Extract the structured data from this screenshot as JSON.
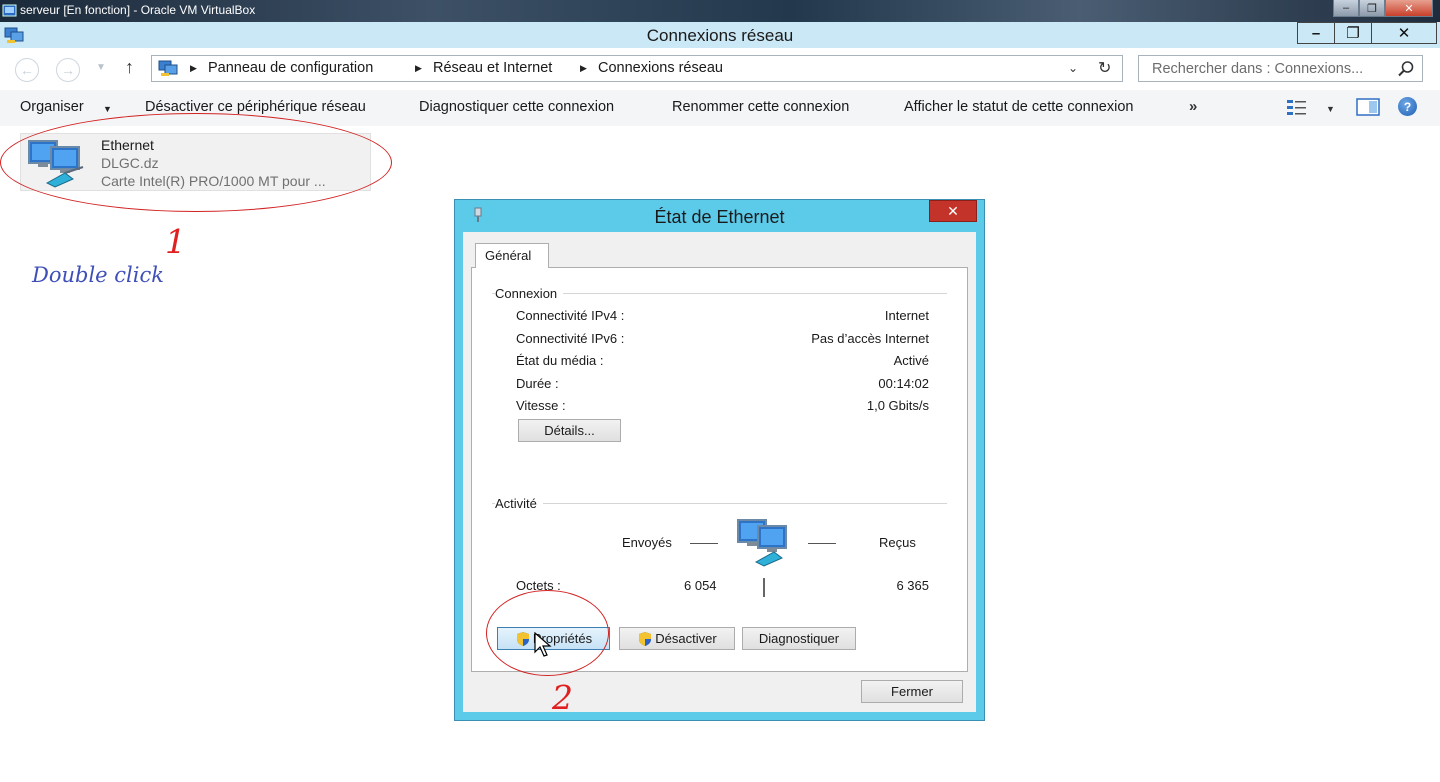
{
  "vbox": {
    "title": "serveur [En fonction] - Oracle VM VirtualBox",
    "close_glyph": "✕",
    "min_glyph": "–",
    "max_glyph": "❐"
  },
  "window": {
    "title": "Connexions réseau",
    "minimize_glyph": "–",
    "restore_glyph": "❐",
    "close_glyph": "✕"
  },
  "address": {
    "back_glyph": "←",
    "forward_glyph": "→",
    "up_glyph": "↑",
    "breadcrumbs": [
      "Panneau de configuration",
      "Réseau et Internet",
      "Connexions réseau"
    ],
    "search_placeholder": "Rechercher dans : Connexions..."
  },
  "toolbar": {
    "organize": "Organiser",
    "disable_device": "Désactiver ce périphérique réseau",
    "diagnose": "Diagnostiquer cette connexion",
    "rename": "Renommer cette connexion",
    "show_status": "Afficher le statut de cette connexion",
    "more": "»",
    "help": "?"
  },
  "ethernet": {
    "name": "Ethernet",
    "domain": "DLGC.dz",
    "adapter": "Carte Intel(R) PRO/1000 MT pour ..."
  },
  "annotations": {
    "step1": "1",
    "step2": "2",
    "double_click": "Double click"
  },
  "dialog": {
    "title": "État de Ethernet",
    "close_glyph": "✕",
    "tab": "Général",
    "connection": {
      "label": "Connexion",
      "rows": [
        {
          "label": "Connectivité IPv4 :",
          "value": "Internet"
        },
        {
          "label": "Connectivité IPv6 :",
          "value": "Pas d’accès Internet"
        },
        {
          "label": "État du média :",
          "value": "Activé"
        },
        {
          "label": "Durée :",
          "value": "00:14:02"
        },
        {
          "label": "Vitesse :",
          "value": "1,0 Gbits/s"
        }
      ],
      "details_button": "Détails..."
    },
    "activity": {
      "label": "Activité",
      "sent_label": "Envoyés",
      "received_label": "Reçus",
      "bytes_label": "Octets :",
      "bytes_sent": "6 054",
      "bytes_received": "6 365"
    },
    "buttons": {
      "properties": "Propriétés",
      "disable": "Désactiver",
      "diagnose": "Diagnostiquer",
      "close": "Fermer"
    }
  },
  "colors": {
    "dialog_frame": "#5ccbea",
    "window_title": "#cbe8f6",
    "annotation_red": "#e02020",
    "annotation_blue": "#3f4fb8",
    "close_red": "#c4332a"
  }
}
